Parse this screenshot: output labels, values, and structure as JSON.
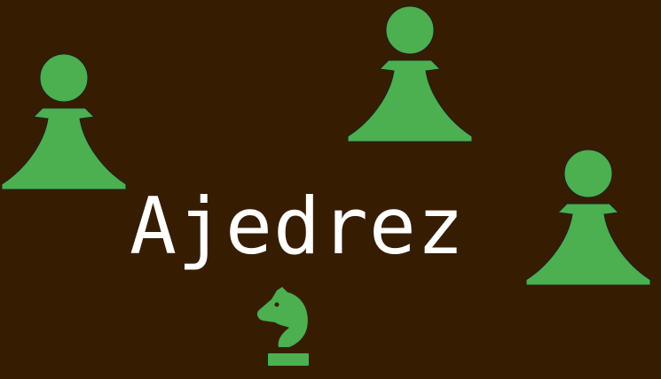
{
  "title": "Ajedrez",
  "colors": {
    "background": "#361d02",
    "piece_fill": "#4caf50",
    "piece_outline": "#1e1e1e",
    "title_text": "#ffffff"
  },
  "pieces": [
    {
      "name": "pawn-icon",
      "kind": "pawn"
    },
    {
      "name": "pawn-icon",
      "kind": "pawn"
    },
    {
      "name": "pawn-icon",
      "kind": "pawn"
    },
    {
      "name": "knight-icon",
      "kind": "knight"
    }
  ]
}
